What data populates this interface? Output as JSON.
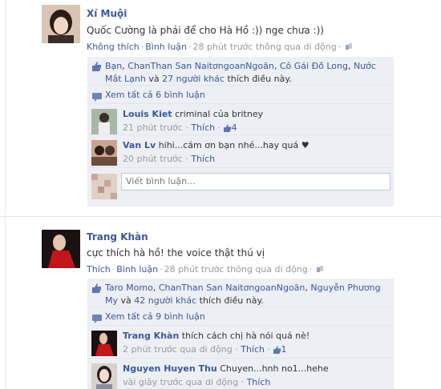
{
  "posts": [
    {
      "author": "Xí Muội",
      "message": "Quốc Cường là phải để cho Hà Hồ :)) nge chưa :))",
      "meta": {
        "like": "Không thích",
        "comment": "Bình luận",
        "time": "28 phút trước thông qua di động"
      },
      "likes": {
        "names": [
          "Bạn",
          "ChanThan San NaitơngoanNgoãn",
          "Cô Gái Đồ Long",
          "Nước Mắt Lạnh"
        ],
        "others": "27 người khác",
        "suffix": "thích điều này.",
        "and_word": "và"
      },
      "view_all": "Xem tất cả 6 bình luận",
      "comments": [
        {
          "name": "Louis Kiet",
          "text": "criminal của britney",
          "time": "21 phút trước",
          "like": "Thích",
          "like_count": "4"
        },
        {
          "name": "Van Lv",
          "text": "hihi...cám ơn bạn nhé...hay quá ♥",
          "time": "20 phút trước",
          "like": "Thích",
          "like_count": ""
        }
      ],
      "write_placeholder": "Viết bình luận..."
    },
    {
      "author": "Trang Khàn",
      "message": "cực thích hà hồ! the voice thật thú vị",
      "meta": {
        "like": "Thích",
        "comment": "Bình luận",
        "time": "28 phút trước thông qua di động"
      },
      "likes": {
        "names": [
          "Taro Momo",
          "ChanThan San NaitơngoanNgoãn",
          "Nguyễn Phương My"
        ],
        "others": "42 người khác",
        "suffix": "thích điều này.",
        "and_word": "và"
      },
      "view_all": "Xem tất cả 9 bình luận",
      "comments": [
        {
          "name": "Trang Khàn",
          "text": "thích cách chị hà nói quá nè!",
          "time": "2 phút trước qua di động",
          "like": "Thích",
          "like_count": "1"
        },
        {
          "name": "Nguyen Huyen Thu",
          "text": "Chuyen...hnh no1...hehe",
          "time": "vài giây trước qua di động",
          "like": "Thích",
          "like_count": ""
        }
      ]
    }
  ],
  "colors": {
    "link": "#3b5998",
    "ufi_bg": "#edeff4",
    "meta": "#999999"
  },
  "icons": [
    "like-thumb-icon",
    "mobile-icon",
    "comment-like-icon"
  ]
}
